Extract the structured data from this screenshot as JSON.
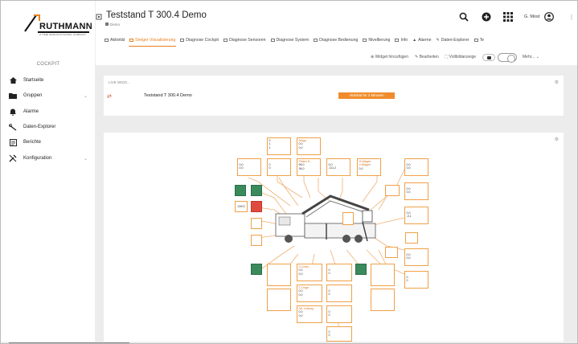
{
  "sidebar": {
    "logo_text": "RUTHMANN",
    "logo_sub": "A  TIME MANUFACTURING COMPANY",
    "section": "COCKPIT",
    "items": [
      {
        "label": "Startseite",
        "icon": "home-icon"
      },
      {
        "label": "Gruppen",
        "icon": "folder-icon",
        "chevron": "⌄"
      },
      {
        "label": "Alarme",
        "icon": "bell-icon"
      },
      {
        "label": "Daten-Explorer",
        "icon": "wand-icon"
      },
      {
        "label": "Berichte",
        "icon": "report-icon"
      },
      {
        "label": "Konfiguration",
        "icon": "tools-icon",
        "chevron": "⌄"
      }
    ]
  },
  "header": {
    "title": "Teststand T 300.4 Demo",
    "breadcrumb": "Demo",
    "user": "G. Most",
    "more": "⋮"
  },
  "tabs": [
    {
      "label": "Aktivität",
      "active": false
    },
    {
      "label": "Steiger Visualisierung",
      "active": true
    },
    {
      "label": "Diagnose Cockpit",
      "active": false
    },
    {
      "label": "Diagnose Sensoren",
      "active": false
    },
    {
      "label": "Diagnose System",
      "active": false
    },
    {
      "label": "Diagnose Bedienung",
      "active": false
    },
    {
      "label": "Nivellierung",
      "active": false
    },
    {
      "label": "Info",
      "active": false
    },
    {
      "label": "Alarme",
      "active": false
    },
    {
      "label": "Daten-Explorer",
      "active": false
    },
    {
      "label": "Te",
      "active": false
    }
  ],
  "toolbar": {
    "add_widget": "⊕ Widget hinzufügen",
    "edit": "✎ Bearbeiten",
    "fullscreen": "⛶ Vollbildanzeige",
    "more": "Mehr... ⌄"
  },
  "live_card": {
    "label": "LIVE WIDG...",
    "device": "Teststand T 300.4 Demo",
    "status": "Aktivität für 2 Minuten",
    "arrow": "⇄"
  },
  "diagram": {
    "top_box_a": [
      "0",
      "1",
      "1"
    ],
    "top_box_b": [
      "Neigu..",
      "0,0",
      "0,0"
    ],
    "left_box_a": [
      "0,0",
      "0,0"
    ],
    "left_box_b": [
      "0",
      "0"
    ],
    "mid_box_a": [
      "Platen H..",
      "96,0",
      "36,0"
    ],
    "mid_box_b": [
      "0,0",
      "-111,2"
    ],
    "right_box_a": [
      "H-Wagen",
      "V-Wagen",
      "0,0"
    ],
    "right_box_b": [
      "0,0",
      "0,0"
    ],
    "right_side_a": [
      "0,0",
      "0,0"
    ],
    "right_side_b": [
      "0,0",
      "-0,1"
    ],
    "right_side_c": [
      "0,0",
      "0,0"
    ],
    "right_side_d": [
      "0",
      "0"
    ],
    "bottom_a": [
      "C-Linke..",
      "0,0",
      "0,0"
    ],
    "bottom_b": [
      "C-Unge..",
      "0,0",
      "0,0"
    ],
    "bottom_c": [
      "Ab. Leitung",
      "0,0",
      "0,0"
    ],
    "bottom_d": [
      "0",
      "0"
    ],
    "bottom_e": [
      "0",
      "0"
    ],
    "bottom_f": [
      "0",
      "0"
    ],
    "bottom_g": [
      "0",
      "0"
    ],
    "oho": "OHO",
    "brand_color": "#e8801e",
    "green": "#3a8a5c",
    "red": "#e04a3c"
  }
}
